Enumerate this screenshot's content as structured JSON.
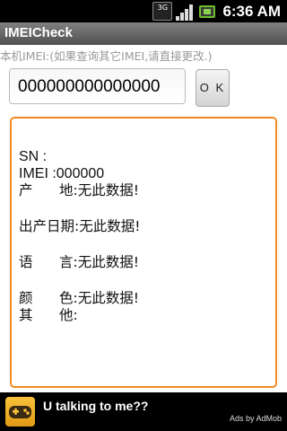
{
  "status_bar": {
    "network_badge": "3G",
    "time": "6:36 AM"
  },
  "app": {
    "title": "IMEICheck"
  },
  "hint": "本机IMEI:(如果查询其它IMEI,请直接更改.)",
  "form": {
    "imei_value": "000000000000000",
    "ok_label": "O K"
  },
  "result": {
    "sn": "SN :",
    "imei": "IMEI :000000",
    "origin": "产      地:无此数据!",
    "production_date": "出产日期:无此数据!",
    "language": "语      言:无此数据!",
    "color": "颜      色:无此数据!",
    "other": "其      他:"
  },
  "ad": {
    "text": "U talking to me??",
    "by": "Ads by AdMob",
    "icon": "gamepad-icon"
  },
  "colors": {
    "panel_border": "#ef8b1f",
    "title_bar": "#6e6e6e",
    "status_bar": "#000000"
  }
}
